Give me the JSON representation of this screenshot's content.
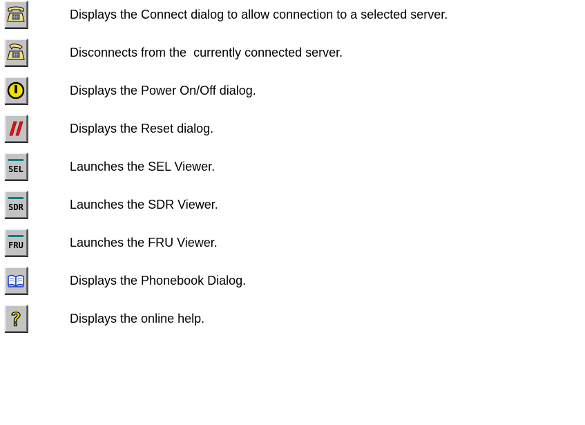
{
  "toolbar_buttons": [
    {
      "icon": "connect-phone-icon",
      "description": "Displays the Connect dialog to allow connection to a selected server."
    },
    {
      "icon": "disconnect-phone-icon",
      "description": "Disconnects from the  currently connected server."
    },
    {
      "icon": "power-icon",
      "description": "Displays the Power On/Off dialog."
    },
    {
      "icon": "reset-icon",
      "description": "Displays the Reset dialog."
    },
    {
      "icon": "sel-viewer-icon",
      "label": "SEL",
      "description": "Launches the SEL Viewer."
    },
    {
      "icon": "sdr-viewer-icon",
      "label": "SDR",
      "description": "Launches the SDR Viewer."
    },
    {
      "icon": "fru-viewer-icon",
      "label": "FRU",
      "description": "Launches the FRU Viewer."
    },
    {
      "icon": "phonebook-icon",
      "description": "Displays the Phonebook Dialog."
    },
    {
      "icon": "help-icon",
      "description": "Displays the online help."
    }
  ],
  "colors": {
    "button_face": "#c3c3c3",
    "power_yellow": "#f2e200",
    "reset_red": "#e01818",
    "viewer_teal": "#008080",
    "phonebook_blue": "#1a3fd0",
    "help_yellow": "#f0e400"
  }
}
